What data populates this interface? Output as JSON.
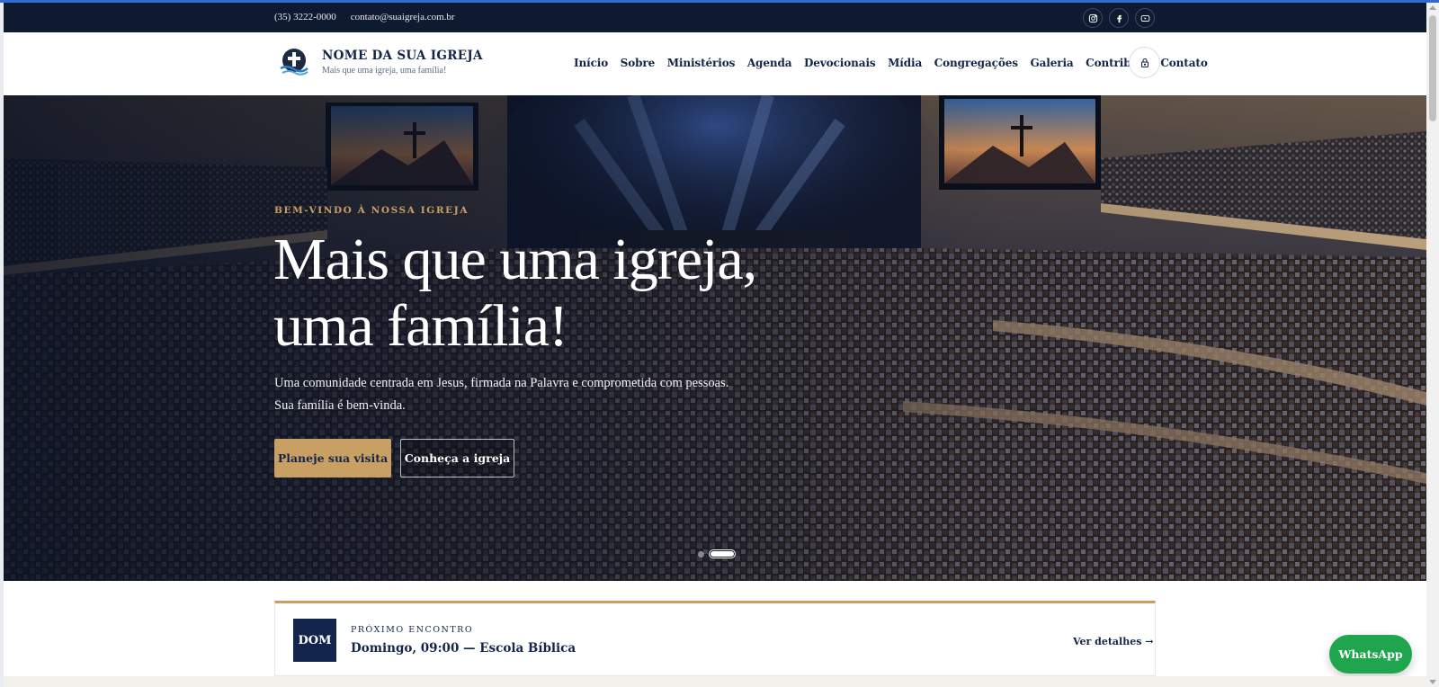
{
  "colors": {
    "navy": "#0e1a30",
    "brand_navy": "#13254a",
    "gold": "#c9a063",
    "whatsapp_green": "#1ea54d"
  },
  "topbar": {
    "phone": "(35) 3222-0000",
    "email": "contato@suaigreja.com.br",
    "socials": [
      {
        "name": "instagram",
        "icon": "instagram-icon"
      },
      {
        "name": "facebook",
        "icon": "facebook-icon"
      },
      {
        "name": "youtube",
        "icon": "youtube-icon"
      }
    ]
  },
  "header": {
    "brand_name": "NOME DA SUA IGREJA",
    "tagline": "Mais que uma igreja, uma família!",
    "nav": [
      "Início",
      "Sobre",
      "Ministérios",
      "Agenda",
      "Devocionais",
      "Mídia",
      "Congregações",
      "Galeria",
      "Contribuir",
      "Contato"
    ],
    "login_icon": "lock-icon"
  },
  "hero": {
    "eyebrow": "BEM-VINDO À NOSSA IGREJA",
    "title_line1": "Mais que uma igreja,",
    "title_line2": "uma família!",
    "text": "Uma comunidade centrada em Jesus, firmada na Palavra e comprometida com pessoas. Sua família é bem-vinda.",
    "primary_cta": "Planeje sua visita",
    "secondary_cta": "Conheça a igreja",
    "slides_total": 2,
    "active_slide": 2
  },
  "next_meeting": {
    "day": "DOM",
    "label": "PRÓXIMO ENCONTRO",
    "title": "Domingo, 09:00 — Escola Bíblica",
    "link": "Ver detalhes →"
  },
  "whatsapp": {
    "label": "WhatsApp"
  }
}
